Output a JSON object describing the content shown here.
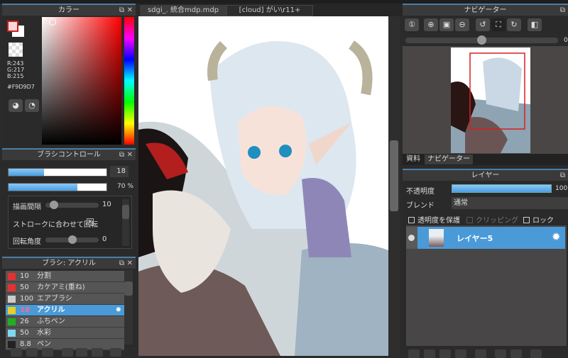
{
  "tabs": [
    "sdgi_. 統合mdp.mdp",
    "[cloud] がい\\r11+"
  ],
  "color_panel": {
    "title": "カラー",
    "r": "R:243",
    "g": "G:217",
    "b": "B:215",
    "hex": "#F9D9D7",
    "fg": "#F9D9D7"
  },
  "brush_control": {
    "title": "ブラシコントロール",
    "size": "18",
    "opacity": "70 %",
    "size_fraction": 0.36,
    "opacity_fraction": 0.7,
    "spacing_label": "描画間隔",
    "spacing_value": "10",
    "rotate_label": "ストロークに合わせて回転",
    "angle_label": "回転角度",
    "angle_value": "0"
  },
  "brush_list": {
    "title": "ブラシ: アクリル",
    "items": [
      {
        "size": "10",
        "name": "分割",
        "color": "#e83030"
      },
      {
        "size": "50",
        "name": "カケアミ(重ね)",
        "color": "#e83030"
      },
      {
        "size": "100",
        "name": "エアブラシ",
        "color": "#cccccc"
      },
      {
        "size": "18",
        "name": "アクリル",
        "color": "#e8d020",
        "selected": true
      },
      {
        "size": "26",
        "name": "ふちペン",
        "color": "#20b020"
      },
      {
        "size": "50",
        "name": "水彩",
        "color": "#80d8f0"
      },
      {
        "size": "8.8",
        "name": "ペン",
        "color": "#222222"
      }
    ]
  },
  "navigator": {
    "title": "ナビゲーター",
    "rotation": "0",
    "tabs": [
      "資料",
      "ナビゲーター"
    ]
  },
  "layers": {
    "title": "レイヤー",
    "opacity_label": "不透明度",
    "opacity_value": "100 %",
    "opacity_fraction": 1.0,
    "blend_label": "ブレンド",
    "blend_value": "通常",
    "protect_label": "透明度を保護",
    "clip_label": "クリッピング",
    "lock_label": "ロック",
    "items": [
      {
        "name": "レイヤー5"
      }
    ]
  }
}
